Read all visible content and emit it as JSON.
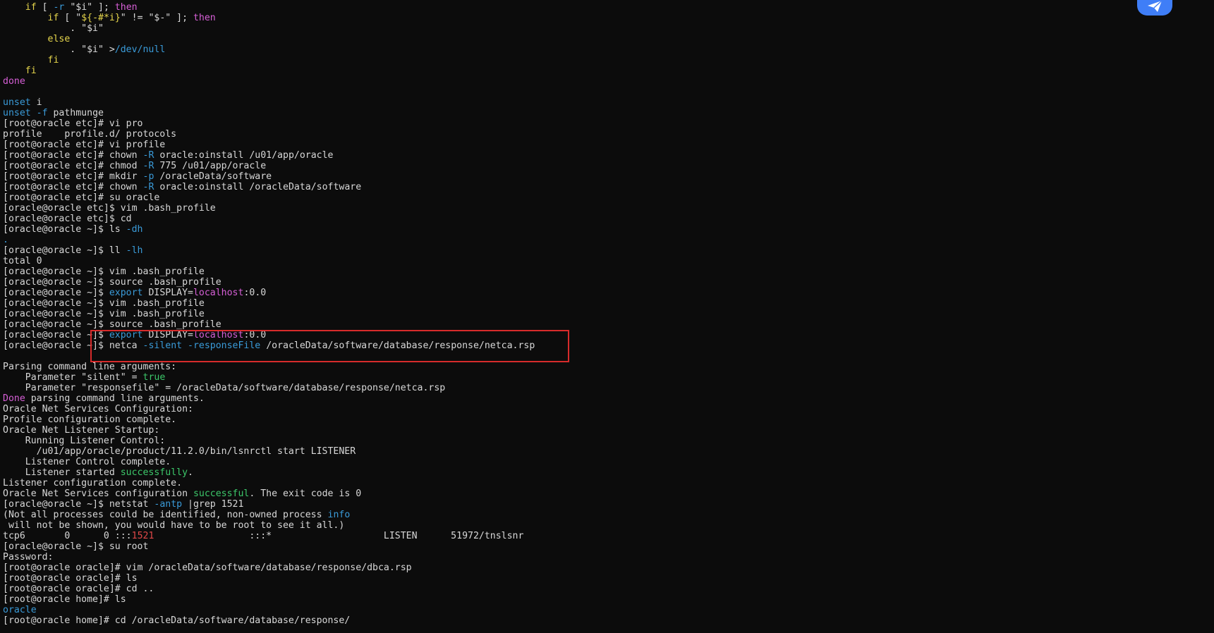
{
  "terminal": {
    "lines": [
      [
        {
          "t": "    ",
          "c": "default"
        },
        {
          "t": "if",
          "c": "yellow"
        },
        {
          "t": " [ ",
          "c": "default"
        },
        {
          "t": "-r",
          "c": "blue"
        },
        {
          "t": " \"$i\" ]; ",
          "c": "default"
        },
        {
          "t": "then",
          "c": "magenta"
        }
      ],
      [
        {
          "t": "        ",
          "c": "default"
        },
        {
          "t": "if",
          "c": "yellow"
        },
        {
          "t": " [ \"",
          "c": "default"
        },
        {
          "t": "${-#*i}",
          "c": "yellow"
        },
        {
          "t": "\" != \"$-\" ]; ",
          "c": "default"
        },
        {
          "t": "then",
          "c": "magenta"
        }
      ],
      [
        {
          "t": "            . \"$i\"",
          "c": "default"
        }
      ],
      [
        {
          "t": "        ",
          "c": "default"
        },
        {
          "t": "else",
          "c": "yellow"
        }
      ],
      [
        {
          "t": "            . \"$i\" >",
          "c": "default"
        },
        {
          "t": "/dev/null",
          "c": "blue"
        }
      ],
      [
        {
          "t": "        ",
          "c": "default"
        },
        {
          "t": "fi",
          "c": "yellow"
        }
      ],
      [
        {
          "t": "    ",
          "c": "default"
        },
        {
          "t": "fi",
          "c": "yellow"
        }
      ],
      [
        {
          "t": "done",
          "c": "magenta"
        }
      ],
      [
        {
          "t": "",
          "c": "default"
        }
      ],
      [
        {
          "t": "unset",
          "c": "blue"
        },
        {
          "t": " i",
          "c": "default"
        }
      ],
      [
        {
          "t": "unset",
          "c": "blue"
        },
        {
          "t": " ",
          "c": "default"
        },
        {
          "t": "-f",
          "c": "blue"
        },
        {
          "t": " pathmunge",
          "c": "default"
        }
      ],
      [
        {
          "t": "[root@oracle etc]# vi pro",
          "c": "default"
        }
      ],
      [
        {
          "t": "profile    profile.d/ protocols",
          "c": "default"
        }
      ],
      [
        {
          "t": "[root@oracle etc]# vi profile",
          "c": "default"
        }
      ],
      [
        {
          "t": "[root@oracle etc]# chown ",
          "c": "default"
        },
        {
          "t": "-R",
          "c": "blue"
        },
        {
          "t": " oracle:oinstall /u01/app/oracle",
          "c": "default"
        }
      ],
      [
        {
          "t": "[root@oracle etc]# chmod ",
          "c": "default"
        },
        {
          "t": "-R",
          "c": "blue"
        },
        {
          "t": " 775 /u01/app/oracle",
          "c": "default"
        }
      ],
      [
        {
          "t": "[root@oracle etc]# mkdir ",
          "c": "default"
        },
        {
          "t": "-p",
          "c": "blue"
        },
        {
          "t": " /oracleData/software",
          "c": "default"
        }
      ],
      [
        {
          "t": "[root@oracle etc]# chown ",
          "c": "default"
        },
        {
          "t": "-R",
          "c": "blue"
        },
        {
          "t": " oracle:oinstall /oracleData/software",
          "c": "default"
        }
      ],
      [
        {
          "t": "[root@oracle etc]# su oracle",
          "c": "default"
        }
      ],
      [
        {
          "t": "[oracle@oracle etc]$ vim .bash_profile",
          "c": "default"
        }
      ],
      [
        {
          "t": "[oracle@oracle etc]$ cd",
          "c": "default"
        }
      ],
      [
        {
          "t": "[oracle@oracle ~]$ ls ",
          "c": "default"
        },
        {
          "t": "-dh",
          "c": "blue"
        }
      ],
      [
        {
          "t": ".",
          "c": "blue"
        }
      ],
      [
        {
          "t": "[oracle@oracle ~]$ ll ",
          "c": "default"
        },
        {
          "t": "-lh",
          "c": "blue"
        }
      ],
      [
        {
          "t": "total 0",
          "c": "default"
        }
      ],
      [
        {
          "t": "[oracle@oracle ~]$ vim .bash_profile",
          "c": "default"
        }
      ],
      [
        {
          "t": "[oracle@oracle ~]$ source .bash_profile",
          "c": "default"
        }
      ],
      [
        {
          "t": "[oracle@oracle ~]$ ",
          "c": "default"
        },
        {
          "t": "export",
          "c": "blue"
        },
        {
          "t": " DISPLAY=",
          "c": "default"
        },
        {
          "t": "localhost",
          "c": "magenta"
        },
        {
          "t": ":0.0",
          "c": "default"
        }
      ],
      [
        {
          "t": "[oracle@oracle ~]$ vim .bash_profile",
          "c": "default"
        }
      ],
      [
        {
          "t": "[oracle@oracle ~]$ vim .bash_profile",
          "c": "default"
        }
      ],
      [
        {
          "t": "[oracle@oracle ~]$ source .bash_profile",
          "c": "default"
        }
      ],
      [
        {
          "t": "[oracle@oracle ~]$ ",
          "c": "default"
        },
        {
          "t": "export",
          "c": "blue"
        },
        {
          "t": " DISPLAY=",
          "c": "default"
        },
        {
          "t": "localhost",
          "c": "magenta"
        },
        {
          "t": ":0.0",
          "c": "default"
        }
      ],
      [
        {
          "t": "[oracle@oracle ~]$ netca ",
          "c": "default"
        },
        {
          "t": "-silent",
          "c": "blue"
        },
        {
          "t": " ",
          "c": "default"
        },
        {
          "t": "-responseFile",
          "c": "blue"
        },
        {
          "t": " /oracleData/software/database/response/netca.rsp",
          "c": "default"
        }
      ],
      [
        {
          "t": "",
          "c": "default"
        }
      ],
      [
        {
          "t": "Parsing command line arguments:",
          "c": "default"
        }
      ],
      [
        {
          "t": "    Parameter \"silent\" = ",
          "c": "default"
        },
        {
          "t": "true",
          "c": "green"
        }
      ],
      [
        {
          "t": "    Parameter \"responsefile\" = /oracleData/software/database/response/netca.rsp",
          "c": "default"
        }
      ],
      [
        {
          "t": "Done",
          "c": "magenta"
        },
        {
          "t": " parsing command line arguments.",
          "c": "default"
        }
      ],
      [
        {
          "t": "Oracle Net Services Configuration:",
          "c": "default"
        }
      ],
      [
        {
          "t": "Profile configuration complete.",
          "c": "default"
        }
      ],
      [
        {
          "t": "Oracle Net Listener Startup:",
          "c": "default"
        }
      ],
      [
        {
          "t": "    Running Listener Control:",
          "c": "default"
        }
      ],
      [
        {
          "t": "      /u01/app/oracle/product/11.2.0/bin/lsnrctl start LISTENER",
          "c": "default"
        }
      ],
      [
        {
          "t": "    Listener Control complete.",
          "c": "default"
        }
      ],
      [
        {
          "t": "    Listener started ",
          "c": "default"
        },
        {
          "t": "successfully",
          "c": "green"
        },
        {
          "t": ".",
          "c": "default"
        }
      ],
      [
        {
          "t": "Listener configuration complete.",
          "c": "default"
        }
      ],
      [
        {
          "t": "Oracle Net Services configuration ",
          "c": "default"
        },
        {
          "t": "successful",
          "c": "green"
        },
        {
          "t": ". The exit code is 0",
          "c": "default"
        }
      ],
      [
        {
          "t": "[oracle@oracle ~]$ netstat ",
          "c": "default"
        },
        {
          "t": "-antp",
          "c": "blue"
        },
        {
          "t": " |grep 1521",
          "c": "default"
        }
      ],
      [
        {
          "t": "(Not all processes could be identified, non-owned process ",
          "c": "default"
        },
        {
          "t": "info",
          "c": "blue"
        }
      ],
      [
        {
          "t": " will not be shown, you would have to be root to see it all.)",
          "c": "default"
        }
      ],
      [
        {
          "t": "tcp6       0      0 :::",
          "c": "default"
        },
        {
          "t": "1521",
          "c": "red"
        },
        {
          "t": "                 :::*                    LISTEN      51972/tnslsnr",
          "c": "default"
        }
      ],
      [
        {
          "t": "[oracle@oracle ~]$ su root",
          "c": "default"
        }
      ],
      [
        {
          "t": "Password:",
          "c": "default"
        }
      ],
      [
        {
          "t": "[root@oracle oracle]# vim /oracleData/software/database/response/dbca.rsp",
          "c": "default"
        }
      ],
      [
        {
          "t": "[root@oracle oracle]# ls",
          "c": "default"
        }
      ],
      [
        {
          "t": "[root@oracle oracle]# cd ..",
          "c": "default"
        }
      ],
      [
        {
          "t": "[root@oracle home]# ls",
          "c": "default"
        }
      ],
      [
        {
          "t": "oracle",
          "c": "blue"
        }
      ],
      [
        {
          "t": "[root@oracle home]# cd /oracleData/software/database/response/",
          "c": "default"
        }
      ]
    ]
  },
  "highlight": {
    "color": "#d72b2b",
    "lines": [
      31,
      32
    ]
  },
  "floating_widget": {
    "icon": "paper-plane-icon",
    "color": "#3f7ef7"
  }
}
